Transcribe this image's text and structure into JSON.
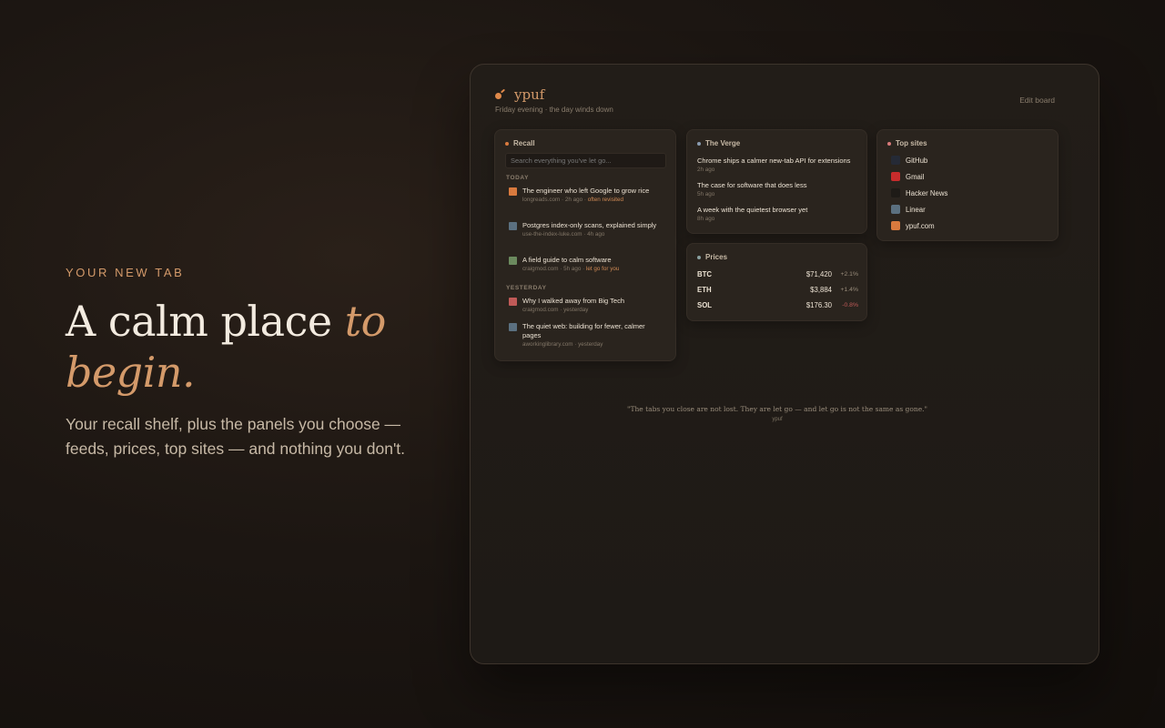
{
  "hero": {
    "eyebrow": "YOUR NEW TAB",
    "headline_main": "A calm place",
    "headline_accent": "to begin.",
    "subcopy": "Your recall shelf, plus the panels you choose — feeds, prices, top sites — and nothing you don't."
  },
  "app": {
    "brand": "ypuf",
    "subtitle": "Friday evening · the day winds down",
    "edit_board": "Edit board",
    "accent_color": "#d49a6a"
  },
  "recall": {
    "title": "Recall",
    "search_placeholder": "Search everything you've let go...",
    "today_label": "TODAY",
    "yesterday_label": "YESTERDAY",
    "today": [
      {
        "title": "The engineer who left Google to grow rice",
        "source": "longreads.com",
        "time": "2h ago",
        "tag": "often revisited",
        "icon_color": "#d97a3e"
      },
      {
        "title": "Postgres index-only scans, explained simply",
        "source": "use-the-index-luke.com",
        "time": "4h ago",
        "tag": "",
        "icon_color": "#5b7080"
      },
      {
        "title": "A field guide to calm software",
        "source": "craigmod.com",
        "time": "5h ago",
        "tag": "let go for you",
        "icon_color": "#6b8a5e"
      }
    ],
    "yesterday": [
      {
        "title": "Why I walked away from Big Tech",
        "source": "craigmod.com",
        "time": "yesterday",
        "tag": "",
        "icon_color": "#c05a58"
      },
      {
        "title": "The quiet web: building for fewer, calmer pages",
        "source": "aworkinglibrary.com",
        "time": "yesterday",
        "tag": "",
        "icon_color": "#5b7080"
      }
    ]
  },
  "verge": {
    "title": "The Verge",
    "items": [
      {
        "title": "Chrome ships a calmer new-tab API for extensions",
        "time": "2h ago"
      },
      {
        "title": "The case for software that does less",
        "time": "5h ago"
      },
      {
        "title": "A week with the quietest browser yet",
        "time": "8h ago"
      }
    ]
  },
  "prices": {
    "title": "Prices",
    "rows": [
      {
        "symbol": "BTC",
        "value": "$71,420",
        "change": "+2.1%",
        "direction": "up"
      },
      {
        "symbol": "ETH",
        "value": "$3,884",
        "change": "+1.4%",
        "direction": "up"
      },
      {
        "symbol": "SOL",
        "value": "$176.30",
        "change": "-0.8%",
        "direction": "down"
      }
    ],
    "up_color": "#9a8d7c",
    "down_color": "#c05a58"
  },
  "topsites": {
    "title": "Top sites",
    "sites": [
      {
        "name": "GitHub",
        "icon": "github-icon",
        "color": "#252a36"
      },
      {
        "name": "Gmail",
        "icon": "gmail-icon",
        "color": "#c72c2c"
      },
      {
        "name": "Hacker News",
        "icon": "hacker-news-icon",
        "color": "#1e1b17"
      },
      {
        "name": "Linear",
        "icon": "linear-icon",
        "color": "#5b7080"
      },
      {
        "name": "ypuf.com",
        "icon": "ypuf-icon",
        "color": "#d97a3e"
      }
    ]
  },
  "quote": {
    "text": "\"The tabs you close are not lost. They are let go — and let go is not the same as gone.\"",
    "author": "ypuf"
  }
}
